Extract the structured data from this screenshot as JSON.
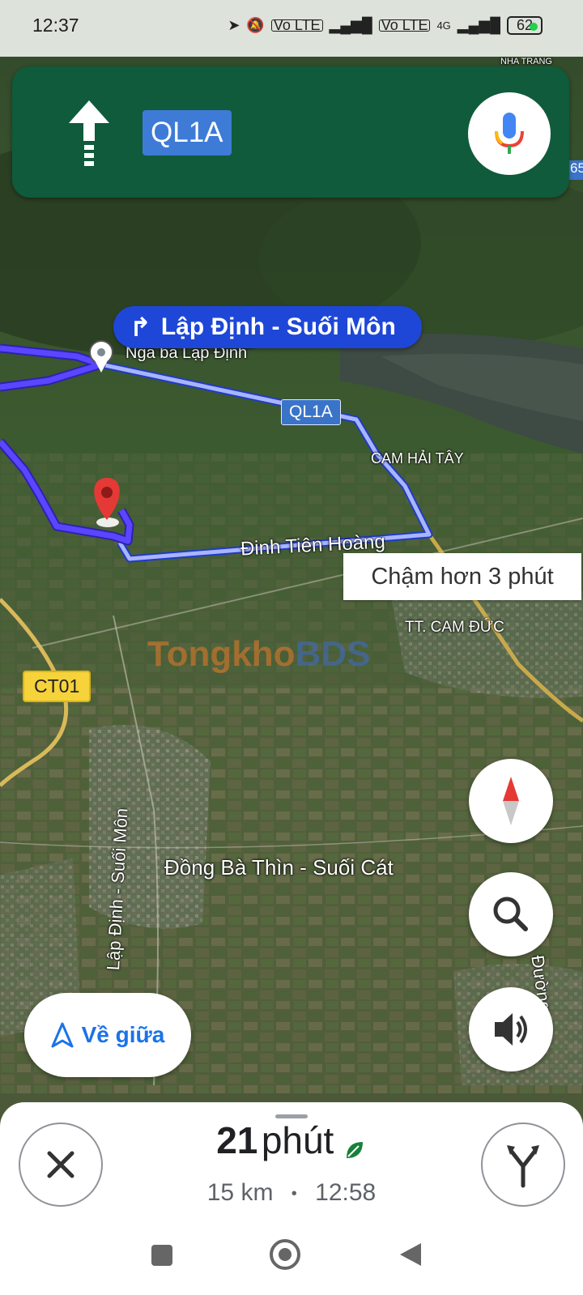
{
  "status_bar": {
    "time": "12:37",
    "network_tag_1": "Vo LTE",
    "network_tag_2": "Vo LTE",
    "network_type": "4G",
    "battery": "62"
  },
  "navigation": {
    "road": "QL1A",
    "maneuver_icon": "straight-arrow-icon",
    "mic_icon": "microphone-icon"
  },
  "route_banner": {
    "text": "Lập Định - Suối Môn",
    "icon": "turn-right-icon"
  },
  "map": {
    "labels": {
      "nga_ba": "Ngã ba Lập Định",
      "cam_hai_tay": "CAM HẢI TÂY",
      "dinh_tien_hoang": "Đinh Tiên Hoàng",
      "tt_cam_duc": "TT. CAM ĐỨC",
      "dong_ba_thin": "Đồng Bà Thìn - Suối Cát",
      "lap_dinh_vertical": "Lập Định - Suối Môn",
      "nha_trang": "NHA TRANG",
      "duong_edge": "Đường",
      "edge_65": "65"
    },
    "shields": {
      "ql1a": "QL1A",
      "ct01": "CT01"
    },
    "alt_route_note": "Chậm hơn 3 phút",
    "watermark_part1": "Tongkho",
    "watermark_part2": "BDS",
    "colors": {
      "route": "#5a46ff",
      "alt_route": "#9aa6ff",
      "nav_card": "#0f5b3c",
      "accent": "#1a73e8"
    }
  },
  "controls": {
    "recenter_label": "Về giữa",
    "compass_icon": "compass-icon",
    "search_icon": "search-icon",
    "sound_icon": "speaker-icon"
  },
  "trip": {
    "duration_value": "21",
    "duration_unit": "phút",
    "distance": "15 km",
    "separator": "•",
    "arrival": "12:58",
    "eco_icon": "leaf-icon"
  }
}
